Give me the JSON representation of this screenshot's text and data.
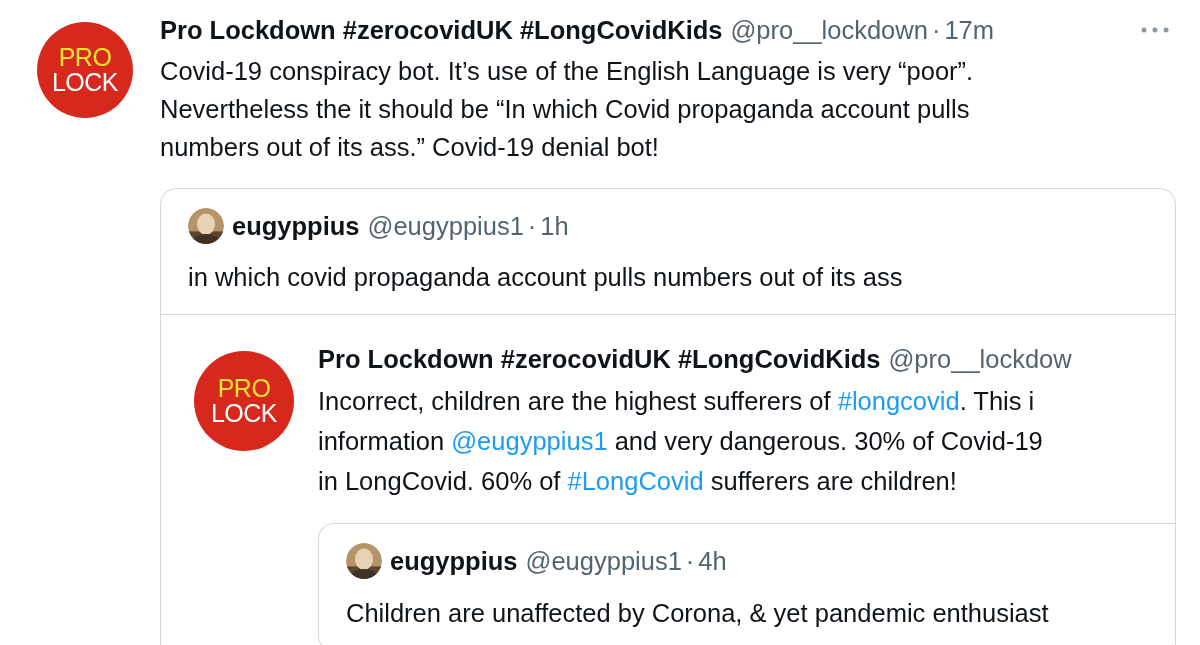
{
  "tweet": {
    "kind": "full",
    "avatar": {
      "kind": "logo",
      "lines": [
        {
          "text": "PRO",
          "color": "#f3e22e"
        },
        {
          "text": "LOCK",
          "color": "#ffffff"
        }
      ]
    },
    "display_name": "Pro Lockdown #zerocovidUK #LongCovidKids",
    "handle": "@pro__lockdown",
    "separator": "·",
    "time": "17m",
    "more_menu": true,
    "body": [
      {
        "kind": "text",
        "text": "Covid-19 conspiracy bot. It’s use of the English Language is very “poor”.\nNevertheless the it should be “In which Covid propaganda account pulls\nnumbers out of its ass.” Covid-19 denial bot!"
      }
    ],
    "quote": {
      "tweets": [
        {
          "kind": "compact",
          "avatar": {
            "kind": "photo"
          },
          "display_name": "eugyppius",
          "handle": "@eugyppius1",
          "separator": "·",
          "time": "1h",
          "body": [
            {
              "kind": "text",
              "text": "in which covid propaganda account pulls numbers out of its ass"
            }
          ]
        },
        {
          "kind": "full",
          "avatar": {
            "kind": "logo",
            "lines": [
              {
                "text": "PRO",
                "color": "#f3e22e"
              },
              {
                "text": "LOCK",
                "color": "#ffffff"
              }
            ]
          },
          "display_name": "Pro Lockdown #zerocovidUK #LongCovidKids",
          "handle": "@pro__lockdow",
          "body": [
            {
              "kind": "text",
              "text": "Incorrect, children are the highest sufferers of "
            },
            {
              "kind": "link",
              "text": "#longcovid"
            },
            {
              "kind": "text",
              "text": ". This i\ninformation "
            },
            {
              "kind": "link",
              "text": "@eugyppius1"
            },
            {
              "kind": "text",
              "text": " and very dangerous. 30% of Covid-19\nin LongCovid. 60% of "
            },
            {
              "kind": "link",
              "text": "#LongCovid"
            },
            {
              "kind": "text",
              "text": " sufferers are children!"
            }
          ],
          "quote": {
            "tweets": [
              {
                "kind": "compact",
                "avatar": {
                  "kind": "photo"
                },
                "display_name": "eugyppius",
                "handle": "@eugyppius1",
                "separator": "·",
                "time": "4h",
                "body": [
                  {
                    "kind": "text",
                    "text": "Children are unaffected by Corona, & yet pandemic enthusiast"
                  }
                ]
              }
            ]
          }
        }
      ]
    }
  }
}
